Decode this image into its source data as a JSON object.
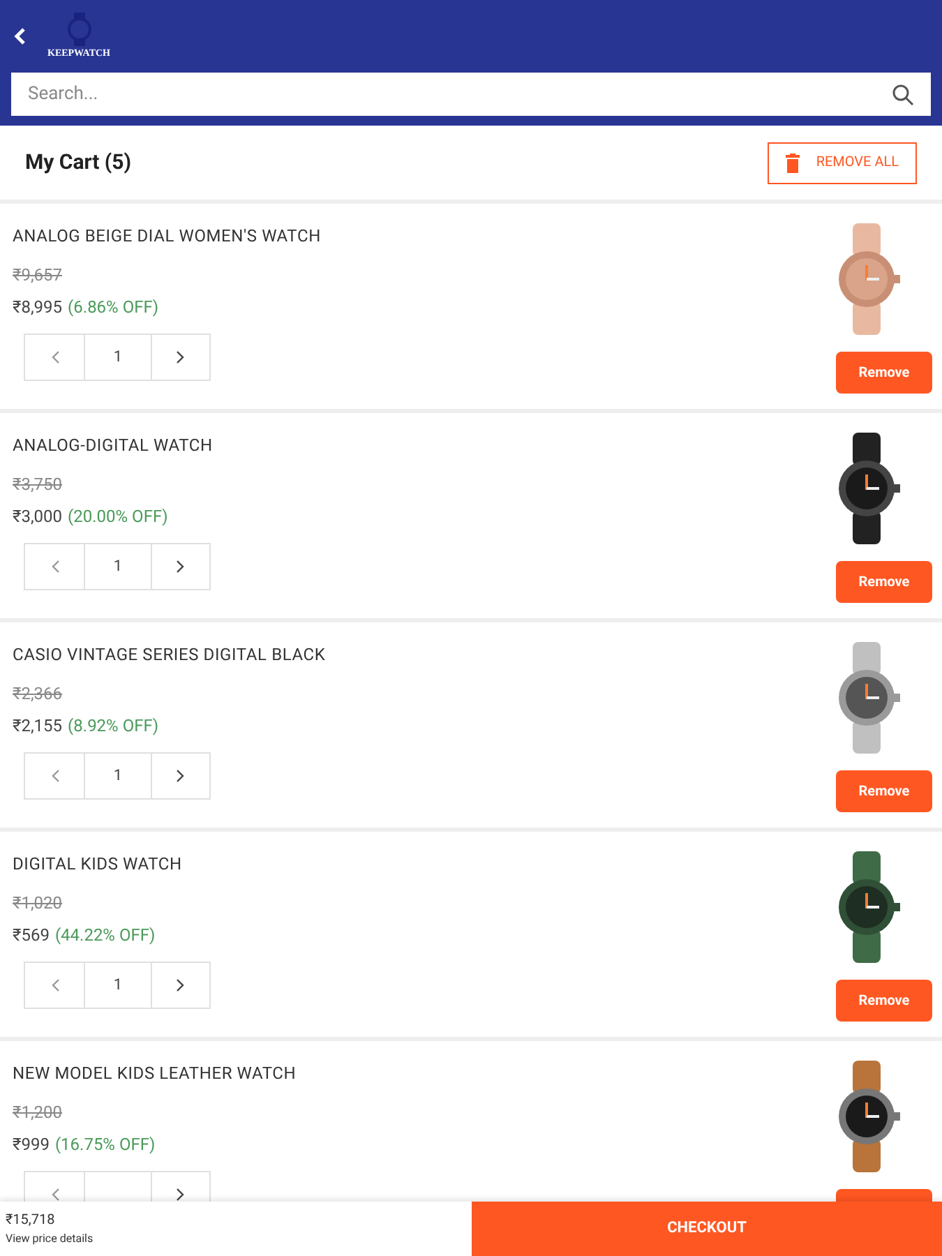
{
  "header": {
    "logo_text": "KEEPWATCH",
    "search": {
      "placeholder": "Search..."
    }
  },
  "cart": {
    "title": "My Cart (5)",
    "remove_all": "REMOVE ALL"
  },
  "items": [
    {
      "name": "ANALOG BEIGE DIAL WOMEN'S WATCH",
      "mrp": "₹9,657",
      "price": "₹8,995",
      "discount": "(6.86% OFF)",
      "quantity": "1",
      "remove": "Remove"
    },
    {
      "name": "ANALOG-DIGITAL WATCH",
      "mrp": "₹3,750",
      "price": "₹3,000",
      "discount": "(20.00% OFF)",
      "quantity": "1",
      "remove": "Remove"
    },
    {
      "name": "CASIO VINTAGE SERIES DIGITAL BLACK",
      "mrp": "₹2,366",
      "price": "₹2,155",
      "discount": "(8.92% OFF)",
      "quantity": "1",
      "remove": "Remove"
    },
    {
      "name": "DIGITAL KIDS WATCH",
      "mrp": "₹1,020",
      "price": "₹569",
      "discount": "(44.22% OFF)",
      "quantity": "1",
      "remove": "Remove"
    },
    {
      "name": "NEW MODEL KIDS LEATHER WATCH",
      "mrp": "₹1,200",
      "price": "₹999",
      "discount": "(16.75% OFF)"
    }
  ],
  "footer": {
    "total": "₹15,718",
    "details_link": "View price details",
    "checkout": "CHECKOUT"
  }
}
